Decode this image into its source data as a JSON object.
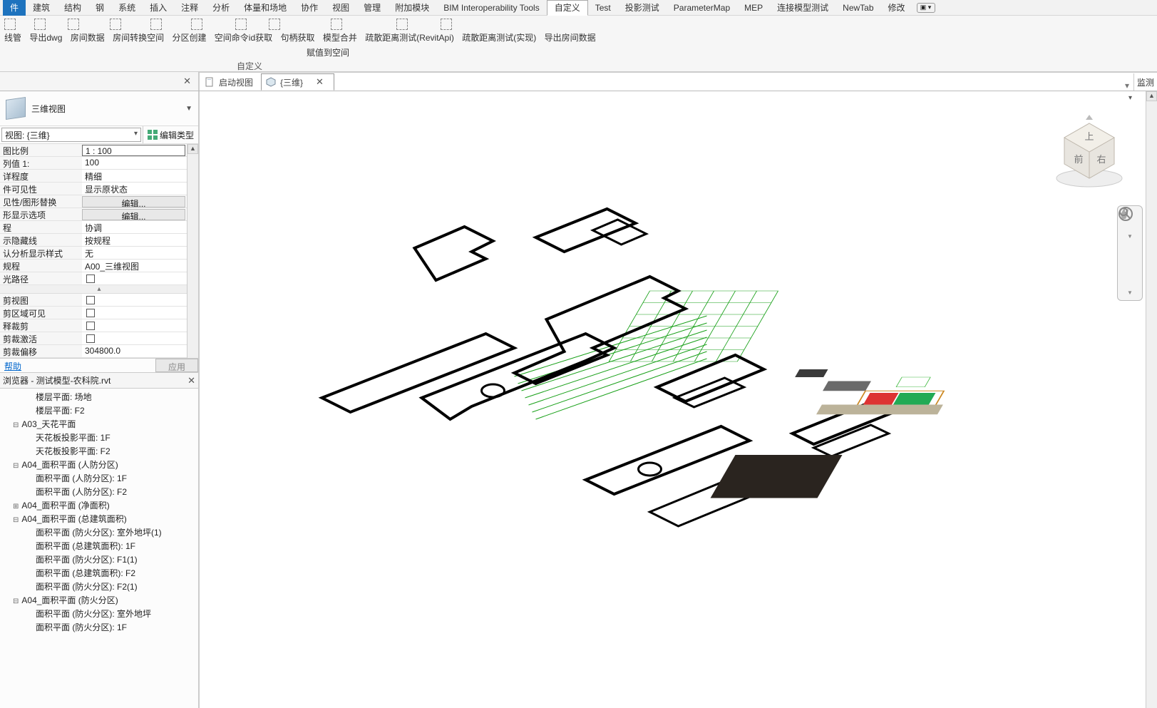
{
  "menu": {
    "file": "件",
    "tabs": [
      "建筑",
      "结构",
      "钢",
      "系统",
      "插入",
      "注释",
      "分析",
      "体量和场地",
      "协作",
      "视图",
      "管理",
      "附加模块",
      "BIM Interoperability Tools",
      "自定义",
      "Test",
      "投影测试",
      "ParameterMap",
      "MEP",
      "连接模型测试",
      "NewTab",
      "修改"
    ],
    "activeTab": "自定义",
    "ribbonRow1": [
      "线管",
      "导出dwg",
      "房间数据",
      "房间转换空间",
      "分区创建",
      "空间命令id获取",
      "句柄获取",
      "模型合并",
      "疏散距离测试(RevitApi)",
      "疏散距离测试(实现)",
      "导出房间数据"
    ],
    "ribbonRow2": "赋值到空间",
    "ribbonPanel": "自定义"
  },
  "docTabs": {
    "start": "启动视图",
    "three_d": "{三维}",
    "rightLabel": "监测"
  },
  "properties": {
    "paletteTitle": "三维视图",
    "viewSelector": "视图: {三维}",
    "editType": "编辑类型",
    "rows": [
      {
        "k": "图比例",
        "v": "1 : 100",
        "framed": true
      },
      {
        "k": "列值 1:",
        "v": "100"
      },
      {
        "k": "详程度",
        "v": "精细"
      },
      {
        "k": "件可见性",
        "v": "显示原状态"
      },
      {
        "k": "见性/图形替换",
        "v": "编辑...",
        "btn": true
      },
      {
        "k": "形显示选项",
        "v": "编辑...",
        "btn": true
      },
      {
        "k": "程",
        "v": "协调"
      },
      {
        "k": "示隐藏线",
        "v": "按规程"
      },
      {
        "k": "认分析显示样式",
        "v": "无"
      },
      {
        "k": "规程",
        "v": "A00_三维视图"
      },
      {
        "k": "光路径",
        "chk": true
      }
    ],
    "rows2": [
      {
        "k": "剪视图",
        "chk": true
      },
      {
        "k": "剪区域可见",
        "chk": true
      },
      {
        "k": "释裁剪",
        "chk": true
      },
      {
        "k": "剪裁激活",
        "chk": true
      },
      {
        "k": "剪裁偏移",
        "v": "304800.0"
      }
    ],
    "help": "帮助",
    "apply": "应用"
  },
  "browser": {
    "title": "浏览器 - 测试模型-农科院.rvt",
    "items": [
      {
        "text": "楼层平面: 场地",
        "type": "leaf"
      },
      {
        "text": "楼层平面: F2",
        "type": "leaf"
      },
      {
        "text": "A03_天花平面",
        "type": "exp"
      },
      {
        "text": "天花板投影平面: 1F",
        "type": "leaf"
      },
      {
        "text": "天花板投影平面: F2",
        "type": "leaf"
      },
      {
        "text": "A04_面积平面 (人防分区)",
        "type": "exp"
      },
      {
        "text": "面积平面 (人防分区): 1F",
        "type": "leaf"
      },
      {
        "text": "面积平面 (人防分区): F2",
        "type": "leaf"
      },
      {
        "text": "A04_面积平面 (净面积)",
        "type": "col"
      },
      {
        "text": "A04_面积平面 (总建筑面积)",
        "type": "exp"
      },
      {
        "text": "面积平面 (防火分区): 室外地坪(1)",
        "type": "leaf"
      },
      {
        "text": "面积平面 (总建筑面积): 1F",
        "type": "leaf"
      },
      {
        "text": "面积平面 (防火分区): F1(1)",
        "type": "leaf"
      },
      {
        "text": "面积平面 (总建筑面积): F2",
        "type": "leaf"
      },
      {
        "text": "面积平面 (防火分区): F2(1)",
        "type": "leaf"
      },
      {
        "text": "A04_面积平面 (防火分区)",
        "type": "exp"
      },
      {
        "text": "面积平面 (防火分区): 室外地坪",
        "type": "leaf"
      },
      {
        "text": "面积平面 (防火分区): 1F",
        "type": "leaf-cut"
      }
    ]
  },
  "viewcube": {
    "top": "上",
    "front": "前",
    "side": "右"
  }
}
